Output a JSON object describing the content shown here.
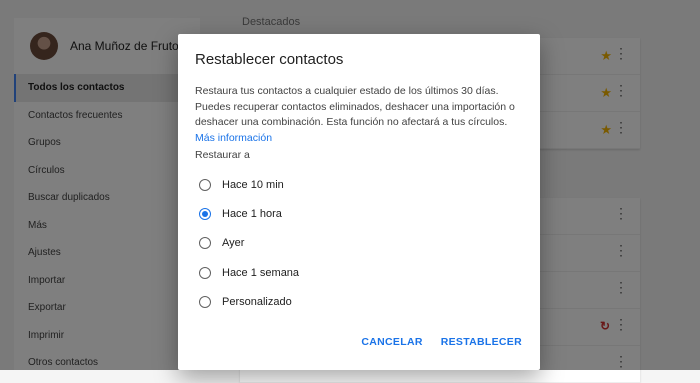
{
  "sidebar": {
    "profile_name": "Ana Muñoz de Frutos",
    "items": [
      {
        "label": "Todos los contactos",
        "active": true
      },
      {
        "label": "Contactos frecuentes"
      },
      {
        "label": "Grupos"
      },
      {
        "label": "Círculos"
      },
      {
        "label": "Buscar duplicados"
      },
      {
        "label": "Más"
      },
      {
        "label": "Ajustes"
      },
      {
        "label": "Importar"
      },
      {
        "label": "Exportar"
      },
      {
        "label": "Imprimir"
      },
      {
        "label": "Otros contactos"
      }
    ]
  },
  "main": {
    "section_title": "Destacados"
  },
  "dialog": {
    "title": "Restablecer contactos",
    "description": "Restaura tus contactos a cualquier estado de los últimos 30 días. Puedes recuperar contactos eliminados, deshacer una importación o deshacer una combinación. Esta función no afectará a tus círculos.",
    "link": "Más información",
    "restore_label": "Restaurar a",
    "options": [
      {
        "label": "Hace 10 min",
        "checked": false
      },
      {
        "label": "Hace 1 hora",
        "checked": true
      },
      {
        "label": "Ayer",
        "checked": false
      },
      {
        "label": "Hace 1 semana",
        "checked": false
      },
      {
        "label": "Personalizado",
        "checked": false
      }
    ],
    "cancel_label": "CANCELAR",
    "restore_button_label": "RESTABLECER"
  },
  "icons": {
    "star": "star-icon",
    "kebab": "more-vert-icon",
    "restore": "restore-icon"
  },
  "colors": {
    "accent": "#1a73e8",
    "star": "#f4b400",
    "scrim": "#000000"
  }
}
